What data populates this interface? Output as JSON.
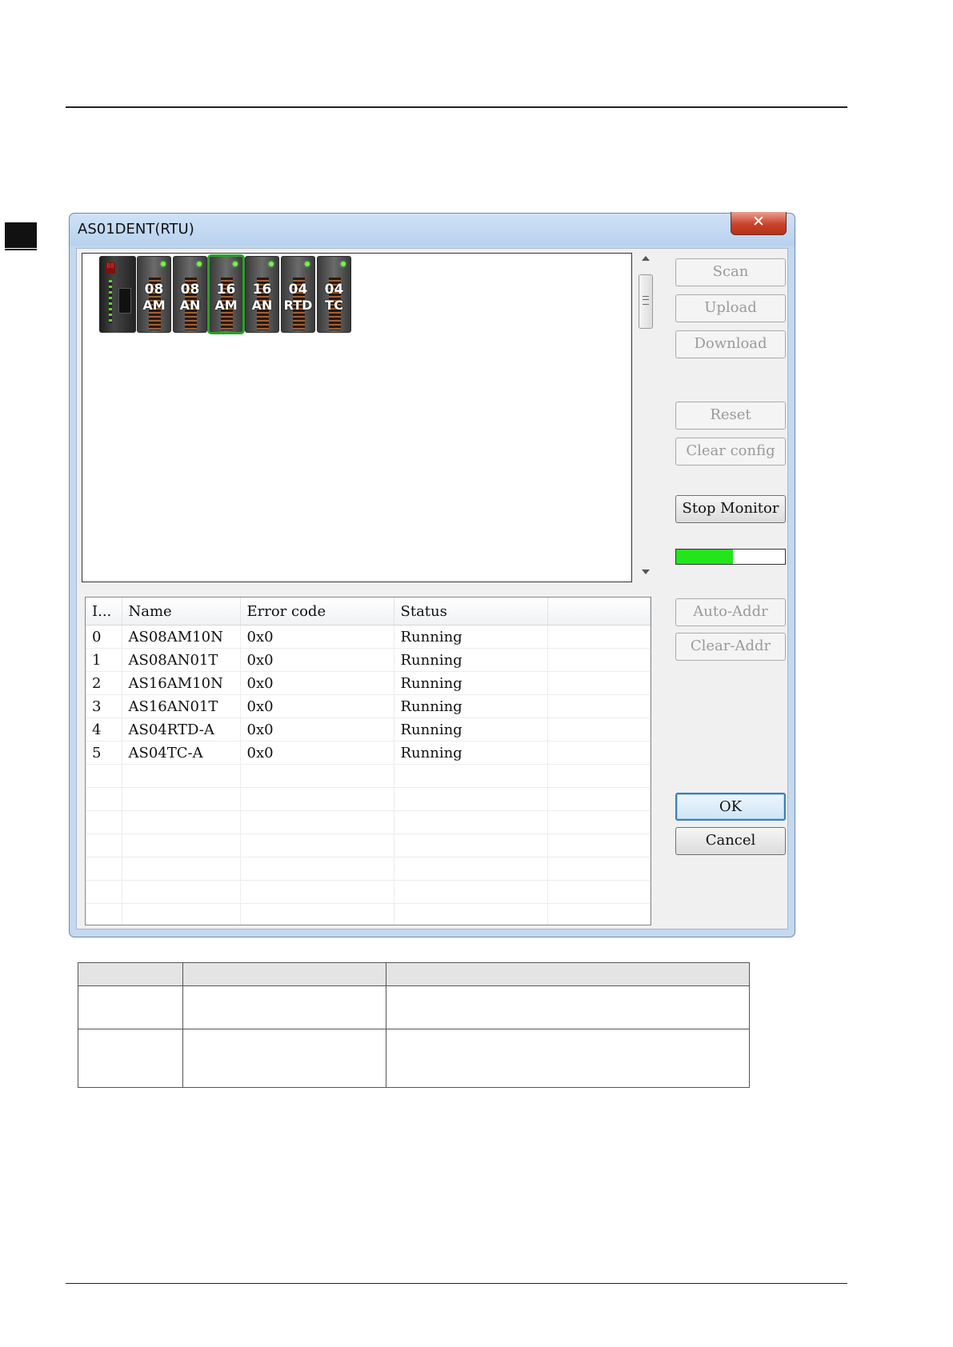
{
  "dialog": {
    "title": "AS01DENT(RTU)",
    "close_glyph": "✕",
    "close_icon": "close-icon"
  },
  "rack": {
    "cpu_display": "88",
    "modules": [
      {
        "line1": "08",
        "line2": "AM",
        "selected": false
      },
      {
        "line1": "08",
        "line2": "AN",
        "selected": false
      },
      {
        "line1": "16",
        "line2": "AM",
        "selected": true
      },
      {
        "line1": "16",
        "line2": "AN",
        "selected": false
      },
      {
        "line1": "04",
        "line2": "RTD",
        "selected": false
      },
      {
        "line1": "04",
        "line2": "TC",
        "selected": false
      }
    ]
  },
  "buttons": {
    "scan": "Scan",
    "upload": "Upload",
    "download": "Download",
    "reset": "Reset",
    "clear_config": "Clear config",
    "stop_monitor": "Stop Monitor",
    "auto_addr": "Auto-Addr",
    "clear_addr": "Clear-Addr",
    "ok": "OK",
    "cancel": "Cancel"
  },
  "monitor_progress": 0.52,
  "colors": {
    "progress_fill": "#23e51c",
    "selected_module_border": "#2aa02a",
    "close_button": "#c9422a"
  },
  "module_table": {
    "headers": [
      "I...",
      "Name",
      "Error code",
      "Status",
      ""
    ],
    "rows": [
      [
        "0",
        "AS08AM10N",
        "0x0",
        "Running"
      ],
      [
        "1",
        "AS08AN01T",
        "0x0",
        "Running"
      ],
      [
        "2",
        "AS16AM10N",
        "0x0",
        "Running"
      ],
      [
        "3",
        "AS16AN01T",
        "0x0",
        "Running"
      ],
      [
        "4",
        "AS04RTD-A",
        "0x0",
        "Running"
      ],
      [
        "5",
        "AS04TC-A",
        "0x0",
        "Running"
      ]
    ],
    "empty_rows": 7
  }
}
